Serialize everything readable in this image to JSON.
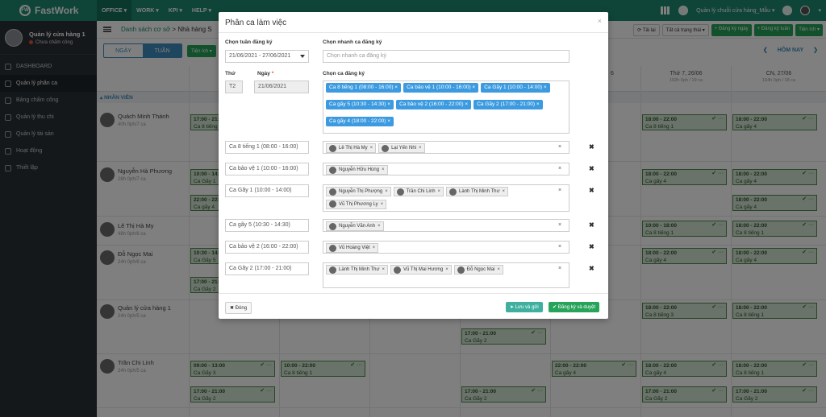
{
  "app": {
    "brand": "FastWork",
    "logo_text": "FW"
  },
  "topnav": [
    "OFFICE",
    "WORK",
    "KPI",
    "HELP"
  ],
  "topright": {
    "org_label": "Quản lý chuỗi cửa hàng_Mẫu"
  },
  "user": {
    "name": "Quản lý cửa hàng 1",
    "status": "Chưa chấm công"
  },
  "sidebar": {
    "items": [
      {
        "label": "DASHBOARD"
      },
      {
        "label": "Quản lý phân ca"
      },
      {
        "label": "Bảng chấm công"
      },
      {
        "label": "Quản lý thu chi"
      },
      {
        "label": "Quản lý tài sản"
      },
      {
        "label": "Hoạt động"
      },
      {
        "label": "Thiết lập"
      }
    ]
  },
  "breadcrumb": {
    "part1": "Danh sách cơ sở",
    "sep": ">",
    "part2": "Nhà hàng S"
  },
  "subbar_buttons": {
    "refresh": "Tải lại",
    "status_filter": "Tất cả trạng thái",
    "register_day": "Đăng ký ngày",
    "register_week": "Đăng ký tuần",
    "utilities": "Tiện ích"
  },
  "view": {
    "day": "NGÀY",
    "week": "TUẦN",
    "utilities": "Tiện ích",
    "today": "HÔM NAY"
  },
  "days": [
    {
      "label": "T",
      "sub": ""
    },
    {
      "label": "",
      "sub": ""
    },
    {
      "label": "",
      "sub": ""
    },
    {
      "label": "",
      "sub": ""
    },
    {
      "label": "6",
      "sub": ""
    },
    {
      "label": "Thứ 7, 26/06",
      "sub": "102h 0ph / 19 ca"
    },
    {
      "label": "CN, 27/06",
      "sub": "104h 0ph / 18 ca"
    }
  ],
  "staff_header": "NHÂN VIÊN",
  "employees": [
    {
      "name": "Quách Minh Thành",
      "stats": "40h 0ph/7 ca"
    },
    {
      "name": "Nguyễn Hà Phương",
      "stats": "28h 0ph/7 ca"
    },
    {
      "name": "Lê Thị Hà My",
      "stats": "48h 0ph/6 ca"
    },
    {
      "name": "Đỗ Ngọc Mai",
      "stats": "24h 0ph/6 ca"
    },
    {
      "name": "Quản lý cửa hàng 1",
      "stats": "24h 0ph/5 ca"
    },
    {
      "name": "Trần Chi Linh",
      "stats": "24h 0ph/5 ca"
    }
  ],
  "shifts": [
    {
      "time": "17:00 - 21:00",
      "name": "Ca 8 tiếng 1"
    },
    {
      "time": "10:00 - 14:00",
      "name": "Ca Gãy 1"
    },
    {
      "time": "22:00 - 22:00",
      "name": "Ca gãy 4"
    },
    {
      "time": "10:30 - 14:30",
      "name": "Ca Gãy 5"
    },
    {
      "time": "17:00 - 21:00",
      "name": "Ca Gãy 2"
    },
    {
      "time": "09:00 - 13:00",
      "name": "Ca Gãy 3"
    },
    {
      "time": "10:00 - 22:00",
      "name": "Ca 8 tiếng 1"
    },
    {
      "time": "17:00 - 21:00",
      "name": "Ca Gãy 2"
    },
    {
      "time": "17:00 - 21:00",
      "name": "Ca Gãy 2"
    },
    {
      "time": "22:00 - 22:00",
      "name": "Ca gãy 4"
    },
    {
      "time": "18:00 - 22:00",
      "name": "Ca 8 tiếng 1"
    },
    {
      "time": "18:00 - 22:00",
      "name": "Ca gãy 4"
    },
    {
      "time": "18:00 - 22:00",
      "name": "Ca gãy 4"
    },
    {
      "time": "18:00 - 22:00",
      "name": "Ca gãy 4"
    },
    {
      "time": "18:00 - 22:00",
      "name": "Ca 8 tiếng 3"
    },
    {
      "time": "10:00 - 18:00",
      "name": "Ca 8 tiếng 1"
    },
    {
      "time": "18:00 - 22:00",
      "name": "Ca gãy 4"
    },
    {
      "time": "10:00 - 18:00",
      "name": "Ca 8 tiếng 1"
    },
    {
      "time": "17:00 - 21:00",
      "name": "Ca Gãy 2"
    },
    {
      "time": "18:00 - 22:00",
      "name": "Ca gãy 4"
    },
    {
      "time": "18:00 - 22:00",
      "name": "Ca 8 tiếng 1"
    },
    {
      "time": "18:00 - 22:00",
      "name": "Ca 8 tiếng 1"
    },
    {
      "time": "18:00 - 22:00",
      "name": "Ca gãy 4"
    },
    {
      "time": "18:00 - 22:00",
      "name": "Ca gãy 4"
    },
    {
      "time": "18:00 - 22:00",
      "name": "Ca 8 tiếng 1"
    },
    {
      "time": "18:00 - 22:00",
      "name": "Ca gãy 4"
    },
    {
      "time": "17:00 - 21:00",
      "name": "Ca Gãy 2"
    },
    {
      "time": "17:00 - 21:00",
      "name": "Ca Gãy 2"
    },
    {
      "time": "17:00 - 21:00",
      "name": "Ca Gãy 2"
    },
    {
      "time": "17:00 - 21:00",
      "name": "Ca Gãy 2"
    }
  ],
  "modal": {
    "title": "Phân ca làm việc",
    "week_label": "Chọn tuần đăng ký",
    "week_value": "21/06/2021 - 27/06/2021",
    "quick_label": "Chọn nhanh ca đăng ký",
    "quick_placeholder": "Chọn nhanh ca đăng ký",
    "thu_label": "Thứ",
    "thu_value": "T2",
    "ngay_label": "Ngày",
    "required_mark": "*",
    "ngay_value": "21/06/2021",
    "ca_label": "Chọn ca đăng ký",
    "selected_shifts": [
      "Ca 8 tiếng 1 (08:00 - 16:00)",
      "Ca bảo vệ 1 (10:00 - 16:00)",
      "Ca Gãy 1 (10:00 - 14:00)",
      "Ca gãy 5 (10:30 - 14:30)",
      "Ca bảo vệ 2 (16:00 - 22:00)",
      "Ca Gãy 2 (17:00 - 21:00)",
      "Ca gãy 4 (18:00 - 22:00)"
    ],
    "assignments": [
      {
        "shift": "Ca 8 tiếng 1 (08:00 - 16:00)",
        "people": [
          "Lê Thị Hà My",
          "Lại Yến Nhi"
        ]
      },
      {
        "shift": "Ca bảo vệ 1 (10:00 - 16:00)",
        "people": [
          "Nguyễn Hữu Hùng"
        ]
      },
      {
        "shift": "Ca Gãy 1 (10:00 - 14:00)",
        "people": [
          "Nguyễn Thị Phượng",
          "Trần Chi Linh",
          "Lành Thị Minh Thư",
          "Vũ Thị Phương Ly"
        ]
      },
      {
        "shift": "Ca gãy 5 (10:30 - 14:30)",
        "people": [
          "Nguyễn Văn Anh"
        ]
      },
      {
        "shift": "Ca bảo vệ 2 (16:00 - 22:00)",
        "people": [
          "Vũ Hoàng Việt"
        ]
      },
      {
        "shift": "Ca Gãy 2 (17:00 - 21:00)",
        "people": [
          "Lành Thị Minh Thư",
          "Vũ Thị Mai Hương",
          "Đỗ Ngọc Mai"
        ]
      }
    ],
    "close_label": "Đóng",
    "save_label": "Lưu và gửi",
    "register_label": "Đăng ký và duyệt"
  }
}
